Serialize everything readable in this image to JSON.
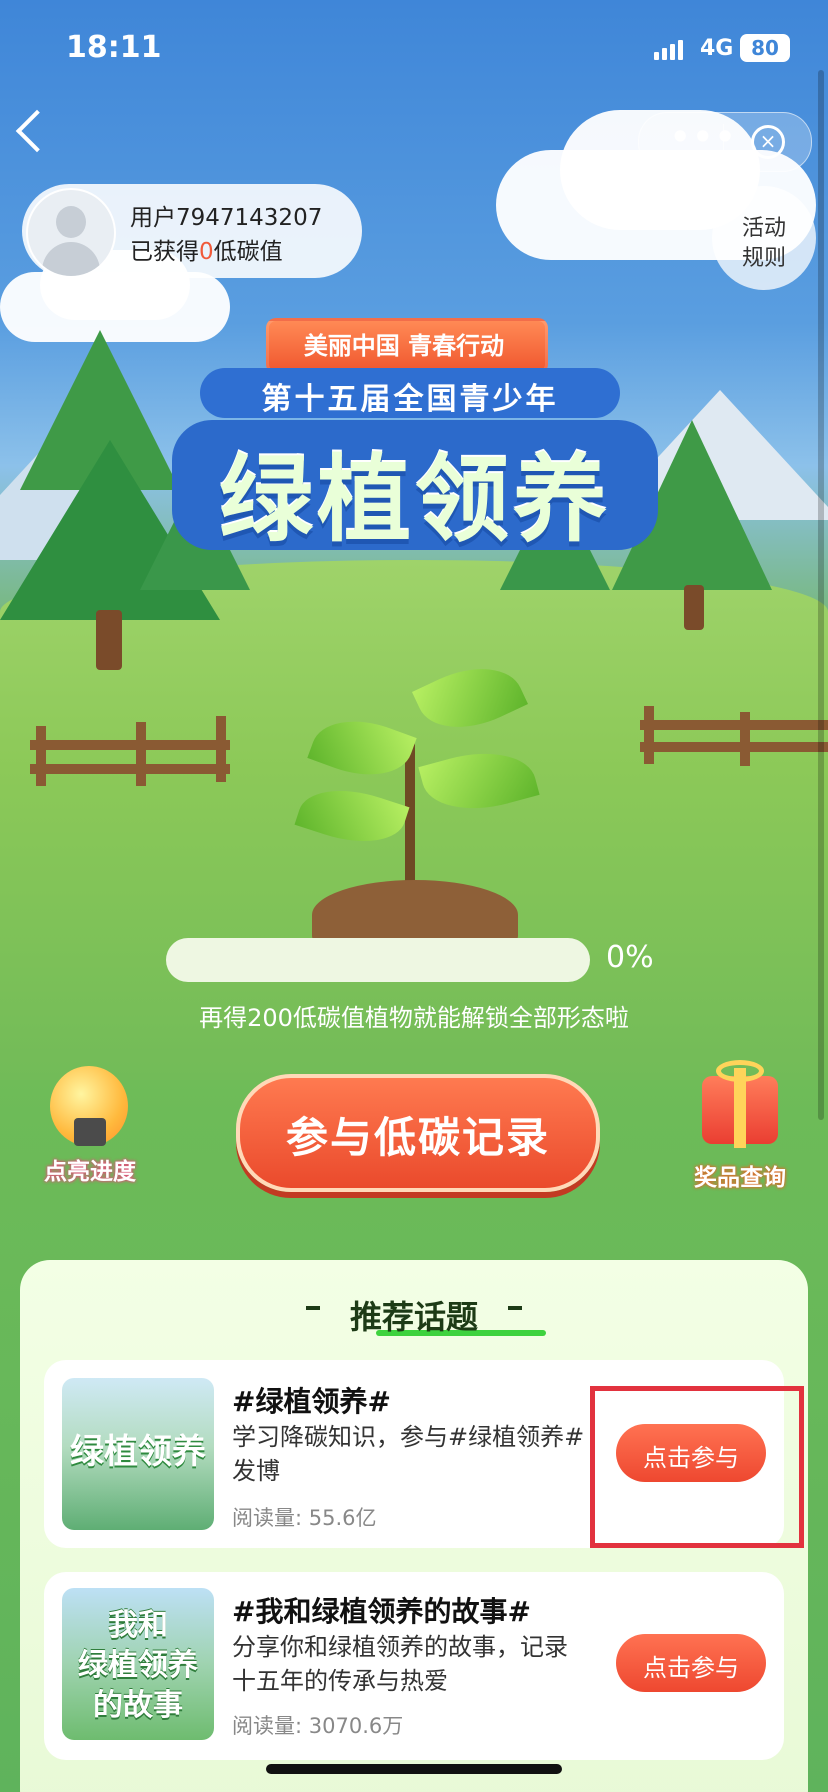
{
  "status_bar": {
    "time": "18:11",
    "network": "4G",
    "battery": "80"
  },
  "nav": {
    "back_icon": "chevron-left-icon",
    "more_icon": "more-dots-icon",
    "close_icon": "close-circle-icon",
    "more_text": "•••",
    "close_text": "×"
  },
  "user": {
    "name": "用户7947143207",
    "carbon_prefix": "已获得",
    "carbon_value": "0",
    "carbon_suffix": "低碳值"
  },
  "rules": {
    "line1": "活动",
    "line2": "规则"
  },
  "event": {
    "banner": "美丽中国 青春行动",
    "subtitle": "第十五届全国青少年",
    "title": "绿植领养"
  },
  "progress": {
    "percent": 0,
    "percent_label": "0%",
    "note": "再得200低碳值植物就能解锁全部形态啦"
  },
  "actions": {
    "join_label": "参与低碳记录",
    "light_label": "点亮进度",
    "prize_label": "奖品查询",
    "light_icon": "lightbulb-icon",
    "prize_icon": "gift-icon"
  },
  "topics": {
    "heading": "推荐话题",
    "items": [
      {
        "title": "#绿植领养#",
        "desc": "学习降碳知识，参与#绿植领养#发博",
        "reads": "阅读量: 55.6亿",
        "button": "点击参与",
        "thumb_text": "绿植领养"
      },
      {
        "title": "#我和绿植领养的故事#",
        "desc": "分享你和绿植领养的故事，记录十五年的传承与热爱",
        "reads": "阅读量: 3070.6万",
        "button": "点击参与",
        "thumb_text": "我和\n绿植领养\n的故事"
      }
    ]
  },
  "colors": {
    "accent": "#f05a3a",
    "green": "#6dbb58",
    "blue": "#2c6acb",
    "highlight": "#e2323e"
  }
}
